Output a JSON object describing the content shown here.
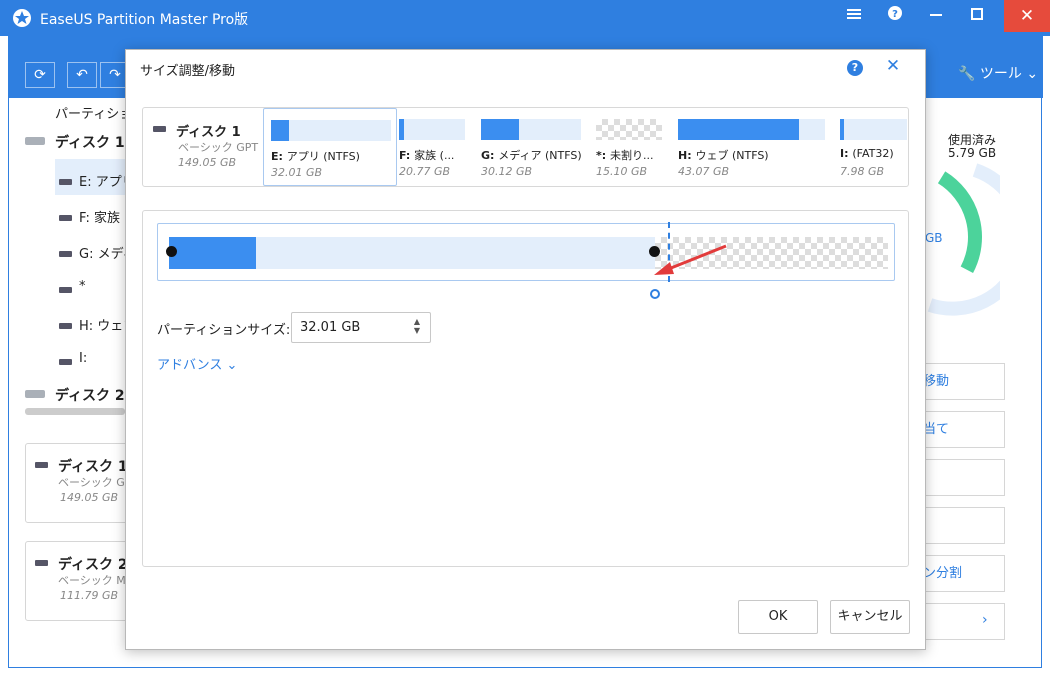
{
  "window": {
    "title": "EaseUS Partition Master Pro版",
    "colors": {
      "accent": "#2f7fe0",
      "fill": "#3b8ef0",
      "close": "#e64b3c",
      "arrow": "#e23b3b"
    }
  },
  "toolbar": {
    "tools_label": "ツール"
  },
  "sidebar": {
    "header": "パーティション",
    "disk1_label": "ディスク 1 (",
    "partitions": [
      {
        "label": "E: アプリ"
      },
      {
        "label": "F: 家族"
      },
      {
        "label": "G: メディ"
      },
      {
        "label": "*"
      },
      {
        "label": "H: ウェブ"
      },
      {
        "label": "I:"
      }
    ],
    "disk2_label": "ディスク 2 ("
  },
  "disk_cards": [
    {
      "name": "ディスク 1",
      "type": "ベーシック GP",
      "size": "149.05 GB"
    },
    {
      "name": "ディスク 2",
      "type": "ベーシック MI",
      "size": "111.79 GB"
    }
  ],
  "right_panel": {
    "used_label": "使用済み",
    "used_value": "5.79 GB",
    "total_fragment": "GB",
    "usage_fraction": 0.3,
    "actions": [
      "移動",
      "当て",
      "",
      "",
      "ン分割",
      ""
    ]
  },
  "dialog": {
    "title": "サイズ調整/移動",
    "disk": {
      "name": "ディスク 1",
      "type": "ベーシック GPT",
      "size": "149.05 GB"
    },
    "partitions": [
      {
        "letter": "E:",
        "name": "アプリ (NTFS)",
        "size": "32.01 GB",
        "fill": 0.15,
        "free": false,
        "selected": true
      },
      {
        "letter": "F:",
        "name": "家族 (...",
        "size": "20.77 GB",
        "fill": 0.07,
        "free": false
      },
      {
        "letter": "G:",
        "name": "メディア (NTFS)",
        "size": "30.12 GB",
        "fill": 0.38,
        "free": false
      },
      {
        "letter": "*:",
        "name": "未割り...",
        "size": "15.10 GB",
        "fill": 0,
        "free": true
      },
      {
        "letter": "H:",
        "name": "ウェブ (NTFS)",
        "size": "43.07 GB",
        "fill": 0.82,
        "free": false
      },
      {
        "letter": "I:",
        "name": "(FAT32)",
        "size": "7.98 GB",
        "fill": 0.03,
        "free": false
      }
    ],
    "resize": {
      "partition_size_label": "パーティションサイズ:",
      "partition_size_value": "32.01 GB",
      "advanced_label": "アドバンス"
    },
    "ok_label": "OK",
    "cancel_label": "キャンセル"
  }
}
